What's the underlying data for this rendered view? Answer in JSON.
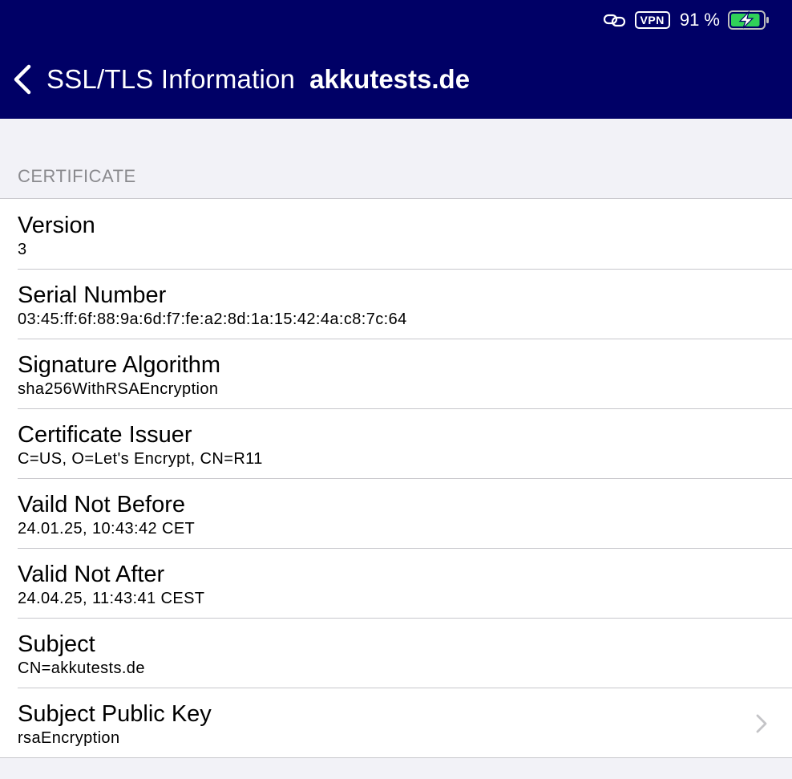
{
  "status_bar": {
    "vpn_label": "VPN",
    "battery_percent": "91 %",
    "battery_level": 0.91,
    "battery_charging": true,
    "icons": [
      "link-icon",
      "battery-icon",
      "charging-bolt-icon"
    ]
  },
  "nav": {
    "back_label": "SSL/TLS Information",
    "title": "akkutests.de",
    "background": "#000066"
  },
  "section": {
    "header": "CERTIFICATE"
  },
  "rows": [
    {
      "title": "Version",
      "value": "3"
    },
    {
      "title": "Serial Number",
      "value": "03:45:ff:6f:88:9a:6d:f7:fe:a2:8d:1a:15:42:4a:c8:7c:64"
    },
    {
      "title": "Signature Algorithm",
      "value": "sha256WithRSAEncryption"
    },
    {
      "title": "Certificate Issuer",
      "value": "C=US, O=Let's Encrypt, CN=R11"
    },
    {
      "title": "Vaild Not Before",
      "value": "24.01.25, 10:43:42 CET"
    },
    {
      "title": "Valid Not After",
      "value": "24.04.25, 11:43:41 CEST"
    },
    {
      "title": "Subject",
      "value": "CN=akkutests.de"
    },
    {
      "title": "Subject Public Key",
      "value": "rsaEncryption",
      "disclosure": "chevron-right-icon"
    }
  ]
}
